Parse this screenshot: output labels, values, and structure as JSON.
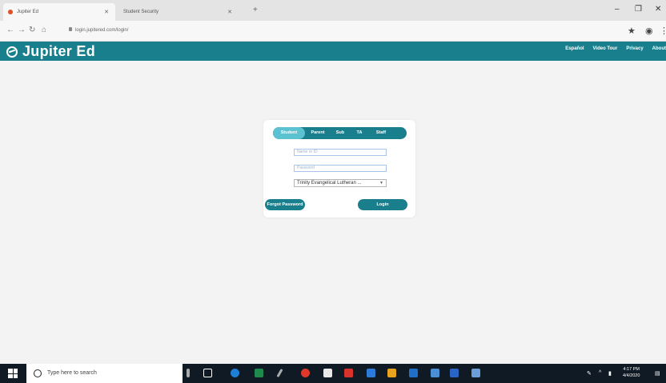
{
  "browser": {
    "tabs": [
      {
        "title": "Jupiter Ed"
      },
      {
        "title": "Student Security"
      }
    ],
    "url": "login.jupitered.com/login/",
    "new_tab": "+",
    "window_controls": {
      "minimize": "–",
      "maximize": "❐",
      "close": "✕"
    },
    "tab_close": "✕"
  },
  "site": {
    "logo_text": "Jupiter Ed",
    "nav": [
      "Español",
      "Video Tour",
      "Privacy",
      "About"
    ],
    "header_color": "#1a7f8d"
  },
  "login": {
    "roles": [
      "Student",
      "Parent",
      "Sub",
      "TA",
      "Staff"
    ],
    "selected_role": "Student",
    "student_id_placeholder": "Name or ID",
    "password_placeholder": "Password",
    "school_value": "Trinity Evangelical Lutheran ...",
    "forgot_label": "Forgot Password",
    "login_label": "Login"
  },
  "taskbar": {
    "search_placeholder": "Type here to search",
    "time": "4:17 PM",
    "date": "4/4/2020"
  }
}
